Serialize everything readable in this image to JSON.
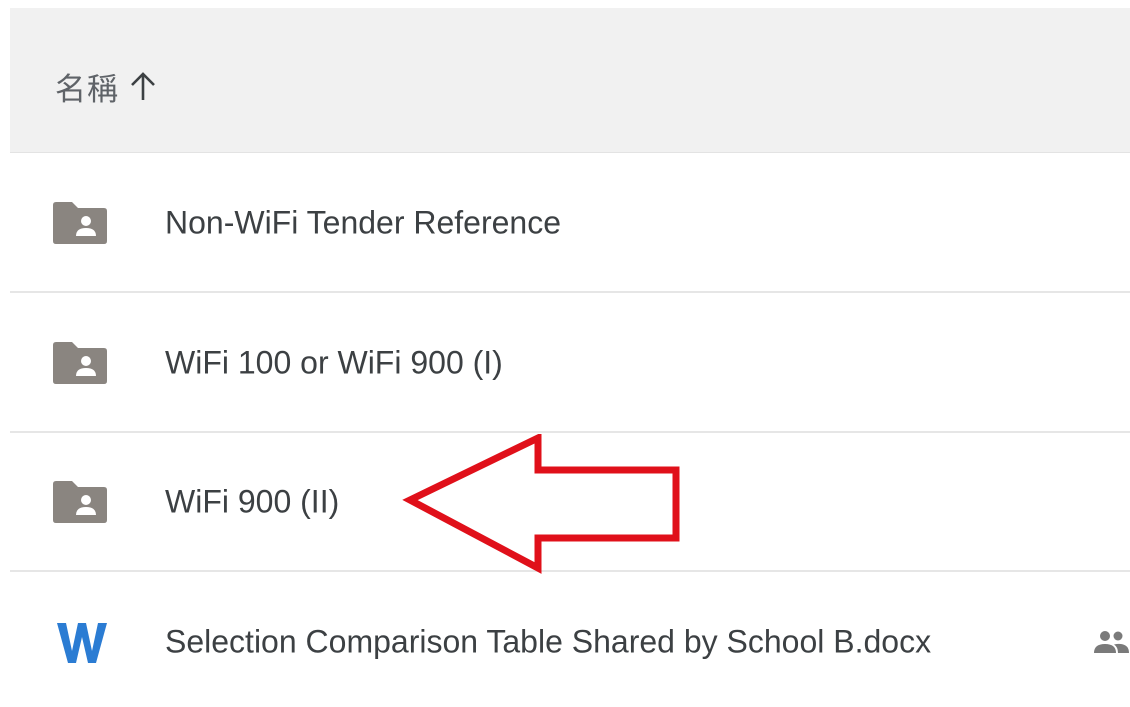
{
  "header": {
    "name_column_label": "名稱",
    "sort_icon": "arrow-up-icon"
  },
  "files": [
    {
      "name": "Non-WiFi Tender Reference",
      "type": "shared-folder",
      "icon": "shared-folder-icon"
    },
    {
      "name": "WiFi 100 or WiFi 900 (I)",
      "type": "shared-folder",
      "icon": "shared-folder-icon"
    },
    {
      "name": "WiFi 900 (II)",
      "type": "shared-folder",
      "icon": "shared-folder-icon"
    },
    {
      "name": "Selection Comparison Table Shared by School B.docx",
      "type": "word-document",
      "icon": "word-doc-icon",
      "shared_icon": "people-icon"
    }
  ],
  "colors": {
    "folder_icon": "#8a8580",
    "word_icon": "#2b7cd3",
    "annotation_arrow": "#e0101a",
    "text": "#3c4043",
    "header_bg": "#f1f1f1"
  },
  "annotation": {
    "shape": "red-arrow-outline",
    "points_to": "WiFi 900 (II)"
  }
}
